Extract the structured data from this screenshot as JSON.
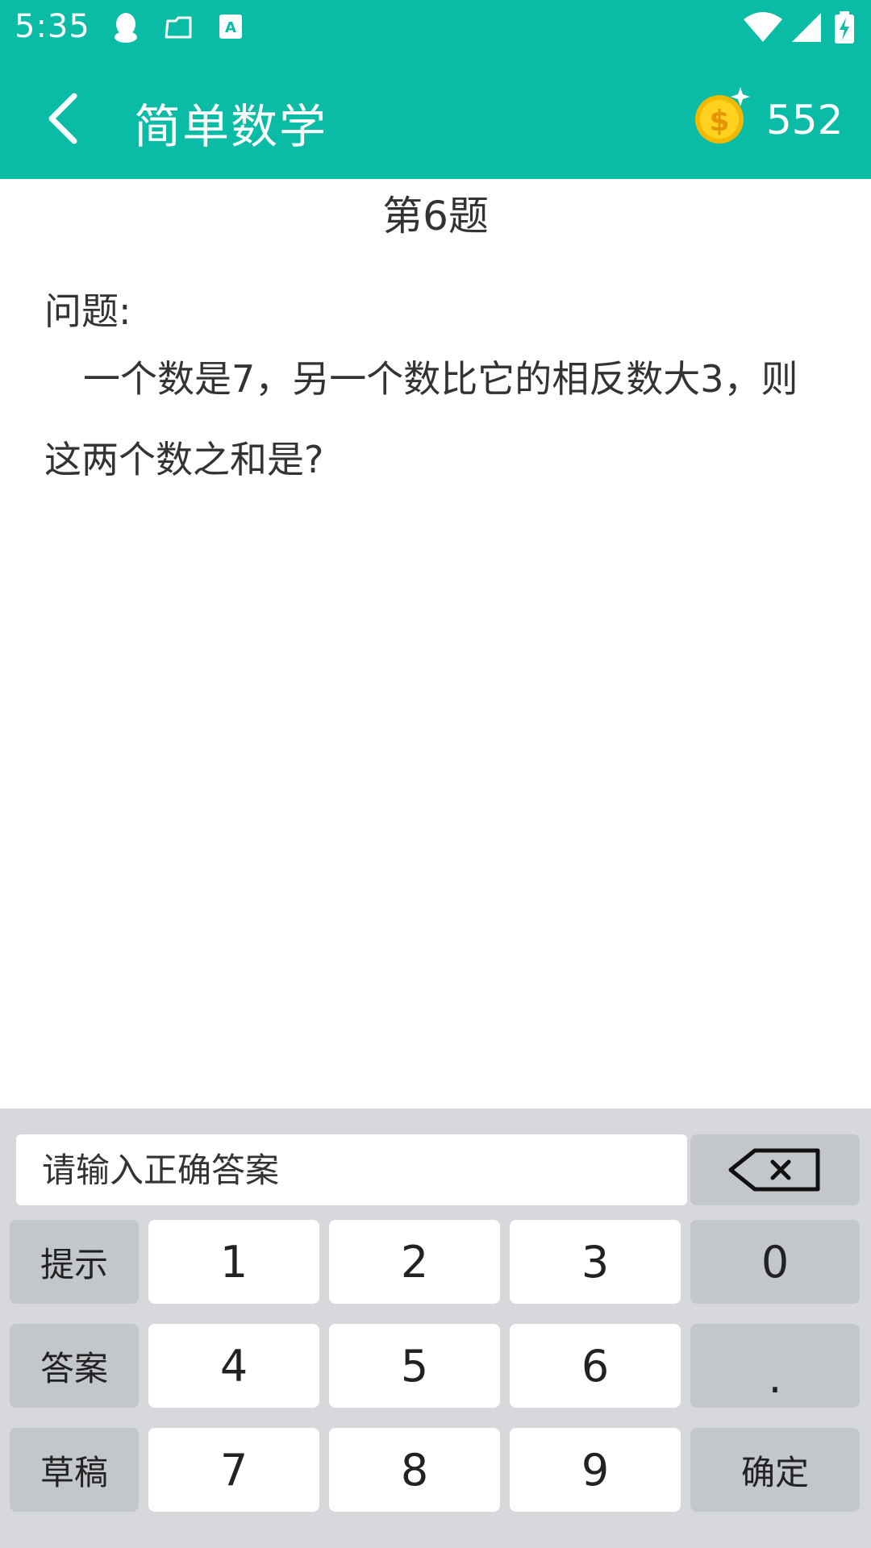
{
  "status_bar": {
    "time": "5:35",
    "left_icons": [
      "qq-icon",
      "folder-icon",
      "keyboard-a-icon"
    ],
    "right_icons": [
      "wifi-icon",
      "signal-icon",
      "battery-charging-icon"
    ]
  },
  "app_bar": {
    "title": "简单数学",
    "coin_count": "552",
    "accent_color": "#0abba5"
  },
  "question": {
    "number": "第6题",
    "label": "问题:",
    "text": "一个数是7，另一个数比它的相反数大3，则这两个数之和是?"
  },
  "keyboard": {
    "input_placeholder": "请输入正确答案",
    "input_value": "",
    "side_keys": {
      "hint": "提示",
      "answer": "答案",
      "draft": "草稿"
    },
    "digits": {
      "k1": "1",
      "k2": "2",
      "k3": "3",
      "k4": "4",
      "k5": "5",
      "k6": "6",
      "k7": "7",
      "k8": "8",
      "k9": "9",
      "k0": "0"
    },
    "dot": ".",
    "confirm": "确定"
  }
}
